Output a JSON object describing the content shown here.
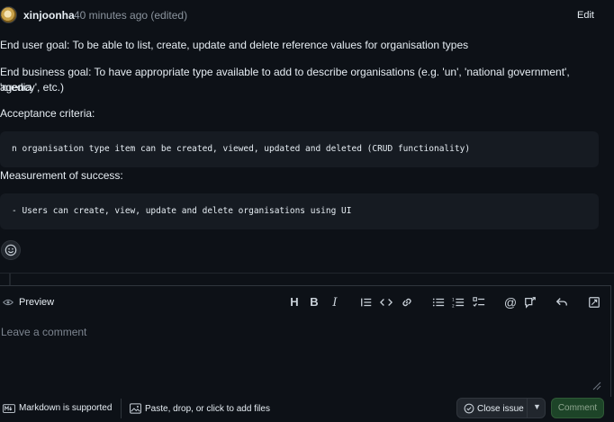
{
  "comment": {
    "author": "xinjoonha",
    "timestamp": "40 minutes ago (edited)",
    "edit_label": "Edit",
    "body": {
      "end_user_goal": "End user goal: To be able to list, create, update and delete reference values for organisation types",
      "end_business_goal_line1": "End business goal: To have appropriate type available to add to describe organisations (e.g. 'un', 'national government', 'media",
      "end_business_goal_line2": "agency', etc.)",
      "acceptance_heading": "Acceptance criteria:",
      "acceptance_code": "n organisation type item can be created, viewed, updated and deleted (CRUD functionality)",
      "measurement_heading": "Measurement of success:",
      "measurement_code": "- Users can create, view, update and delete organisations using UI"
    },
    "reaction_icon": "smiley-icon"
  },
  "editor": {
    "preview_tab": "Preview",
    "toolbar": [
      "heading-icon",
      "bold-icon",
      "italic-icon",
      "quote-icon",
      "code-icon",
      "link-icon",
      "unordered-list-icon",
      "ordered-list-icon",
      "task-list-icon",
      "mention-icon",
      "cross-reference-icon",
      "reply-icon",
      "fullscreen-icon"
    ],
    "placeholder": "Leave a comment"
  },
  "footer": {
    "markdown_note": "Markdown is supported",
    "attach_note": "Paste, drop, or click to add files",
    "close_issue_label": "Close issue",
    "comment_label": "Comment"
  },
  "colors": {
    "background": "#0d1117",
    "code_bg": "#161b22",
    "muted": "#8b949e",
    "comment_button_bg": "#1d4428"
  }
}
